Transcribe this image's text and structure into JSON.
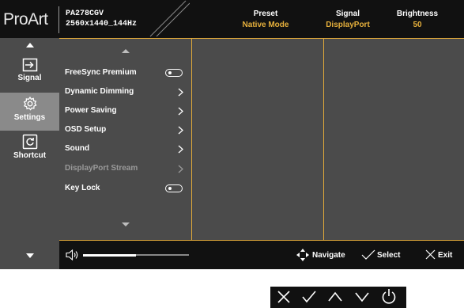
{
  "header": {
    "logo": "ProArt",
    "model": "PA278CGV",
    "resolution": "2560x1440_144Hz",
    "preset_label": "Preset",
    "preset_value": "Native Mode",
    "signal_label": "Signal",
    "signal_value": "DisplayPort",
    "brightness_label": "Brightness",
    "brightness_value": "50"
  },
  "sidebar": {
    "items": [
      {
        "label": "Signal",
        "icon": "input-icon"
      },
      {
        "label": "Settings",
        "icon": "gear-icon",
        "active": true
      },
      {
        "label": "Shortcut",
        "icon": "shortcut-icon"
      }
    ]
  },
  "menu": {
    "items": [
      {
        "label": "FreeSync Premium",
        "control": "toggle",
        "enabled": true,
        "state": "off"
      },
      {
        "label": "Dynamic Dimming",
        "control": "chevron",
        "enabled": true
      },
      {
        "label": "Power Saving",
        "control": "chevron",
        "enabled": true
      },
      {
        "label": "OSD Setup",
        "control": "chevron",
        "enabled": true
      },
      {
        "label": "Sound",
        "control": "chevron",
        "enabled": true
      },
      {
        "label": "DisplayPort Stream",
        "control": "chevron",
        "enabled": false
      },
      {
        "label": "Key Lock",
        "control": "toggle",
        "enabled": true,
        "state": "off"
      }
    ]
  },
  "footer": {
    "volume_fraction": 0.5,
    "navigate_label": "Navigate",
    "select_label": "Select",
    "exit_label": "Exit"
  },
  "keys": [
    "close-icon",
    "check-icon",
    "up-icon",
    "down-icon",
    "power-icon"
  ],
  "colors": {
    "accent": "#e0a93a",
    "value_text": "#e6b03c",
    "header_bg": "#111111",
    "panel_bg": "#4b4b4b",
    "active_bg": "#8a8a8a"
  }
}
